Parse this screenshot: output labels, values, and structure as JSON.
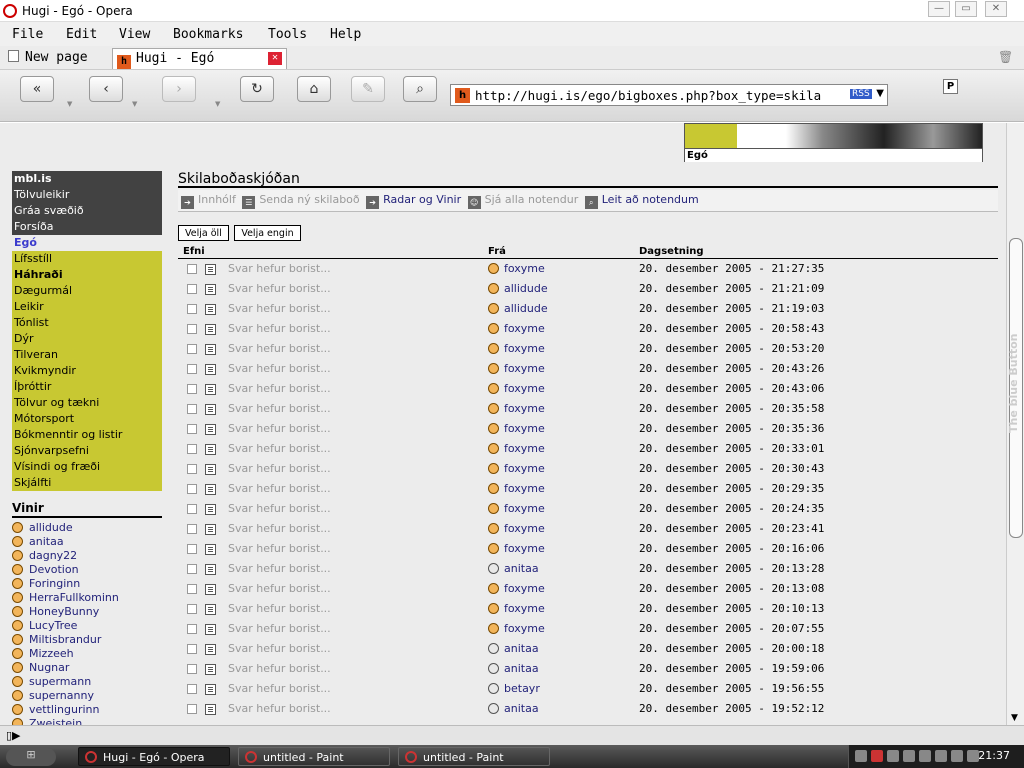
{
  "window": {
    "title": "Hugi - Egó - Opera"
  },
  "menu": [
    "File",
    "Edit",
    "View",
    "Bookmarks",
    "Tools",
    "Help"
  ],
  "tabs": [
    {
      "label": "New page"
    },
    {
      "label": "Hugi - Egó"
    }
  ],
  "address": {
    "url": "http://hugi.is/ego/bigboxes.php?box_type=skila",
    "rss": "RSS"
  },
  "banner": {
    "label": "Egó"
  },
  "leftnav": {
    "grey_items": [
      "mbl.is",
      "Tölvuleikir",
      "Gráa svæðið",
      "Forsíða"
    ],
    "selected": "Egó",
    "yellow_items": [
      "Lífsstíll",
      "Háhraði",
      "Dægurmál",
      "Leikir",
      "Tónlist",
      "Dýr",
      "Tilveran",
      "Kvikmyndir",
      "Íþróttir",
      "Tölvur og tækni",
      "Mótorsport",
      "Bókmenntir og listir",
      "Sjónvarpsefni",
      "Vísindi og fræði",
      "Skjálfti"
    ]
  },
  "friends": {
    "heading": "Vinir",
    "items": [
      "allidude",
      "anitaa",
      "dagny22",
      "Devotion",
      "Foringinn",
      "HerraFullkominn",
      "HoneyBunny",
      "LucyTree",
      "Miltisbrandur",
      "Mizzeeh",
      "Nugnar",
      "supermann",
      "supernanny",
      "vettlingurinn",
      "Zweistein"
    ]
  },
  "main": {
    "heading": "Skilaboðaskjóðan",
    "subnav": {
      "inbox": "Innhólf",
      "send": "Senda ný skilaboð",
      "radar": "Radar og Vinir",
      "all_users": "Sjá alla notendur",
      "search": "Leit að notendum"
    },
    "select_all": "Velja öll",
    "select_none": "Velja engin",
    "columns": {
      "subject": "Efni",
      "from": "Frá",
      "date": "Dagsetning"
    },
    "messages": [
      {
        "subject": "Svar hefur borist...",
        "from": "foxyme",
        "date": "20. desember 2005 - 21:27:35"
      },
      {
        "subject": "Svar hefur borist...",
        "from": "allidude",
        "date": "20. desember 2005 - 21:21:09"
      },
      {
        "subject": "Svar hefur borist...",
        "from": "allidude",
        "date": "20. desember 2005 - 21:19:03"
      },
      {
        "subject": "Svar hefur borist...",
        "from": "foxyme",
        "date": "20. desember 2005 - 20:58:43"
      },
      {
        "subject": "Svar hefur borist...",
        "from": "foxyme",
        "date": "20. desember 2005 - 20:53:20"
      },
      {
        "subject": "Svar hefur borist...",
        "from": "foxyme",
        "date": "20. desember 2005 - 20:43:26"
      },
      {
        "subject": "Svar hefur borist...",
        "from": "foxyme",
        "date": "20. desember 2005 - 20:43:06"
      },
      {
        "subject": "Svar hefur borist...",
        "from": "foxyme",
        "date": "20. desember 2005 - 20:35:58"
      },
      {
        "subject": "Svar hefur borist...",
        "from": "foxyme",
        "date": "20. desember 2005 - 20:35:36"
      },
      {
        "subject": "Svar hefur borist...",
        "from": "foxyme",
        "date": "20. desember 2005 - 20:33:01"
      },
      {
        "subject": "Svar hefur borist...",
        "from": "foxyme",
        "date": "20. desember 2005 - 20:30:43"
      },
      {
        "subject": "Svar hefur borist...",
        "from": "foxyme",
        "date": "20. desember 2005 - 20:29:35"
      },
      {
        "subject": "Svar hefur borist...",
        "from": "foxyme",
        "date": "20. desember 2005 - 20:24:35"
      },
      {
        "subject": "Svar hefur borist...",
        "from": "foxyme",
        "date": "20. desember 2005 - 20:23:41"
      },
      {
        "subject": "Svar hefur borist...",
        "from": "foxyme",
        "date": "20. desember 2005 - 20:16:06"
      },
      {
        "subject": "Svar hefur borist...",
        "from": "anitaa",
        "date": "20. desember 2005 - 20:13:28"
      },
      {
        "subject": "Svar hefur borist...",
        "from": "foxyme",
        "date": "20. desember 2005 - 20:13:08"
      },
      {
        "subject": "Svar hefur borist...",
        "from": "foxyme",
        "date": "20. desember 2005 - 20:10:13"
      },
      {
        "subject": "Svar hefur borist...",
        "from": "foxyme",
        "date": "20. desember 2005 - 20:07:55"
      },
      {
        "subject": "Svar hefur borist...",
        "from": "anitaa",
        "date": "20. desember 2005 - 20:00:18"
      },
      {
        "subject": "Svar hefur borist...",
        "from": "anitaa",
        "date": "20. desember 2005 - 19:59:06"
      },
      {
        "subject": "Svar hefur borist...",
        "from": "betayr",
        "date": "20. desember 2005 - 19:56:55"
      },
      {
        "subject": "Svar hefur borist...",
        "from": "anitaa",
        "date": "20. desember 2005 - 19:52:12"
      }
    ]
  },
  "sidebar_panel": {
    "label": "The blue Button"
  },
  "taskbar": {
    "tasks": [
      "Hugi - Egó - Opera",
      "untitled - Paint",
      "untitled - Paint"
    ],
    "clock": "21:37"
  },
  "colors": {
    "nav_yellow": "#c8c832",
    "nav_grey": "#424242",
    "link_blue": "#23237a"
  }
}
